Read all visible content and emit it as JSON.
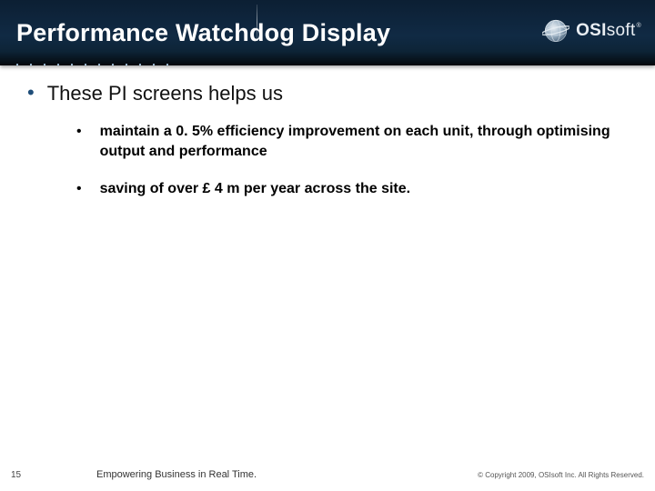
{
  "header": {
    "title": "Performance Watchdog Display",
    "logo_text_prefix": "OSI",
    "logo_text_suffix": "soft",
    "logo_tm": "®"
  },
  "main": {
    "bullet_l1": "These PI screens helps us",
    "bullet_l1_marker": "•",
    "sub_marker": "•",
    "sub_items": [
      " maintain a 0. 5% efficiency improvement on each unit, through optimising output and performance",
      "saving of over £ 4 m per year across the site."
    ]
  },
  "footer": {
    "page": "15",
    "tagline": "Empowering Business in Real Time.",
    "copyright": "© Copyright 2009, OSIsoft Inc.  All Rights Reserved."
  }
}
